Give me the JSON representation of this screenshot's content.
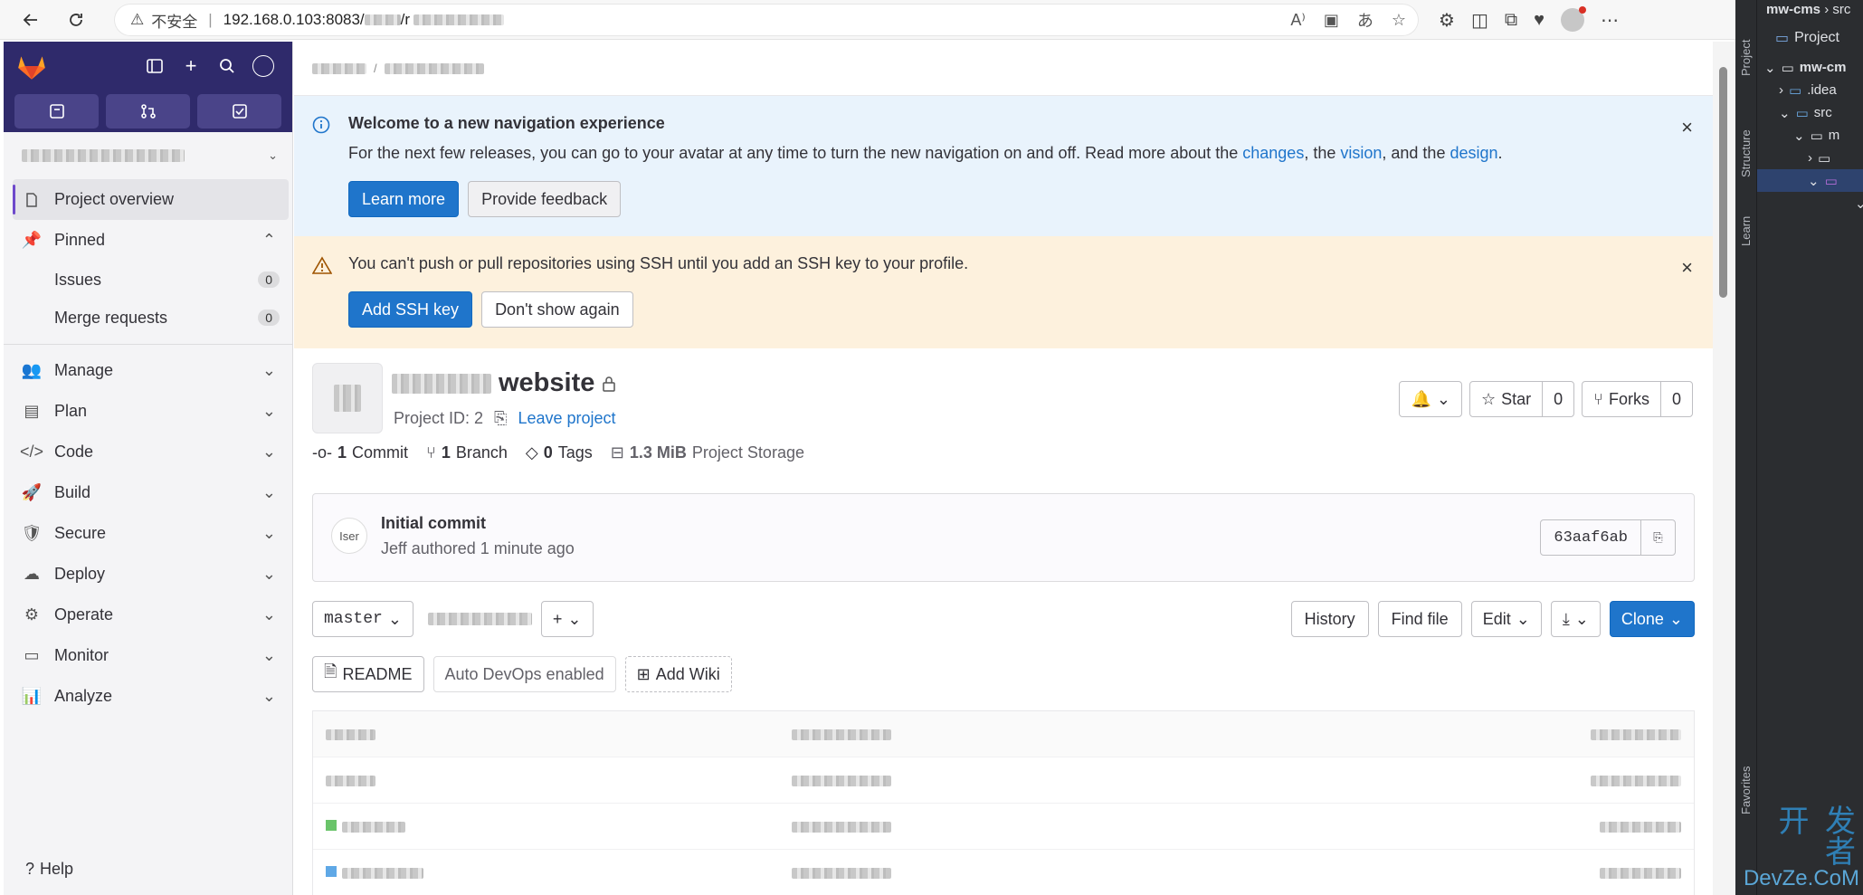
{
  "browser": {
    "insecure_label": "不安全",
    "url_visible": "192.168.0.103:8083/",
    "url_sep": "/r"
  },
  "sidebar": {
    "pinned_label": "Pinned",
    "active_item": "Project overview",
    "pinned_items": [
      {
        "label": "Issues",
        "count": "0"
      },
      {
        "label": "Merge requests",
        "count": "0"
      }
    ],
    "items": [
      {
        "label": "Manage"
      },
      {
        "label": "Plan"
      },
      {
        "label": "Code"
      },
      {
        "label": "Build"
      },
      {
        "label": "Secure"
      },
      {
        "label": "Deploy"
      },
      {
        "label": "Operate"
      },
      {
        "label": "Monitor"
      },
      {
        "label": "Analyze"
      }
    ],
    "help_label": "Help"
  },
  "alerts": {
    "nav": {
      "title": "Welcome to a new navigation experience",
      "body_prefix": "For the next few releases, you can go to your avatar at any time to turn the new navigation on and off. Read more about the ",
      "link1": "changes",
      "mid1": ", the ",
      "link2": "vision",
      "mid2": ", and the ",
      "link3": "design",
      "end": ".",
      "learn_more": "Learn more",
      "feedback": "Provide feedback"
    },
    "ssh": {
      "body": "You can't push or pull repositories using SSH until you add an SSH key to your profile.",
      "add_key": "Add SSH key",
      "dismiss": "Don't show again"
    }
  },
  "project": {
    "name_visible": "website",
    "id_text": "Project ID: 2",
    "leave": "Leave project",
    "star_label": "Star",
    "star_count": "0",
    "forks_label": "Forks",
    "forks_count": "0",
    "stats": {
      "commits_num": "1",
      "commits_label": "Commit",
      "branches_num": "1",
      "branches_label": "Branch",
      "tags_num": "0",
      "tags_label": "Tags",
      "storage_num": "1.3 MiB",
      "storage_label": "Project Storage"
    }
  },
  "commit": {
    "title": "Initial commit",
    "meta": "Jeff authored 1 minute ago",
    "avatar_alt": "Iser",
    "sha": "63aaf6ab"
  },
  "repo": {
    "branch": "master",
    "history": "History",
    "find_file": "Find file",
    "edit": "Edit",
    "clone": "Clone",
    "chips": {
      "readme": "README",
      "devops": "Auto DevOps enabled",
      "wiki": "Add Wiki"
    }
  },
  "ide": {
    "crumb_root": "mw-cms",
    "crumb_sep": "›",
    "crumb_next": "src",
    "tab": "Project",
    "strip_project": "Project",
    "strip_structure": "Structure",
    "strip_learn": "Learn",
    "strip_favorites": "Favorites",
    "tree": [
      {
        "label": "mw-cm",
        "indent": 0
      },
      {
        "label": ".idea",
        "indent": 1
      },
      {
        "label": "src",
        "indent": 1
      },
      {
        "label": "m",
        "indent": 2
      }
    ],
    "watermark_top": "开 发 者",
    "watermark_bottom": "DevZe.CoM"
  },
  "colors": {
    "gitlab_sidebar_top": "#2f2a6b",
    "primary": "#1f75cb",
    "info_bg": "#e9f3fc",
    "warn_bg": "#fdf1dd",
    "ide_bg": "#2b2d30"
  }
}
